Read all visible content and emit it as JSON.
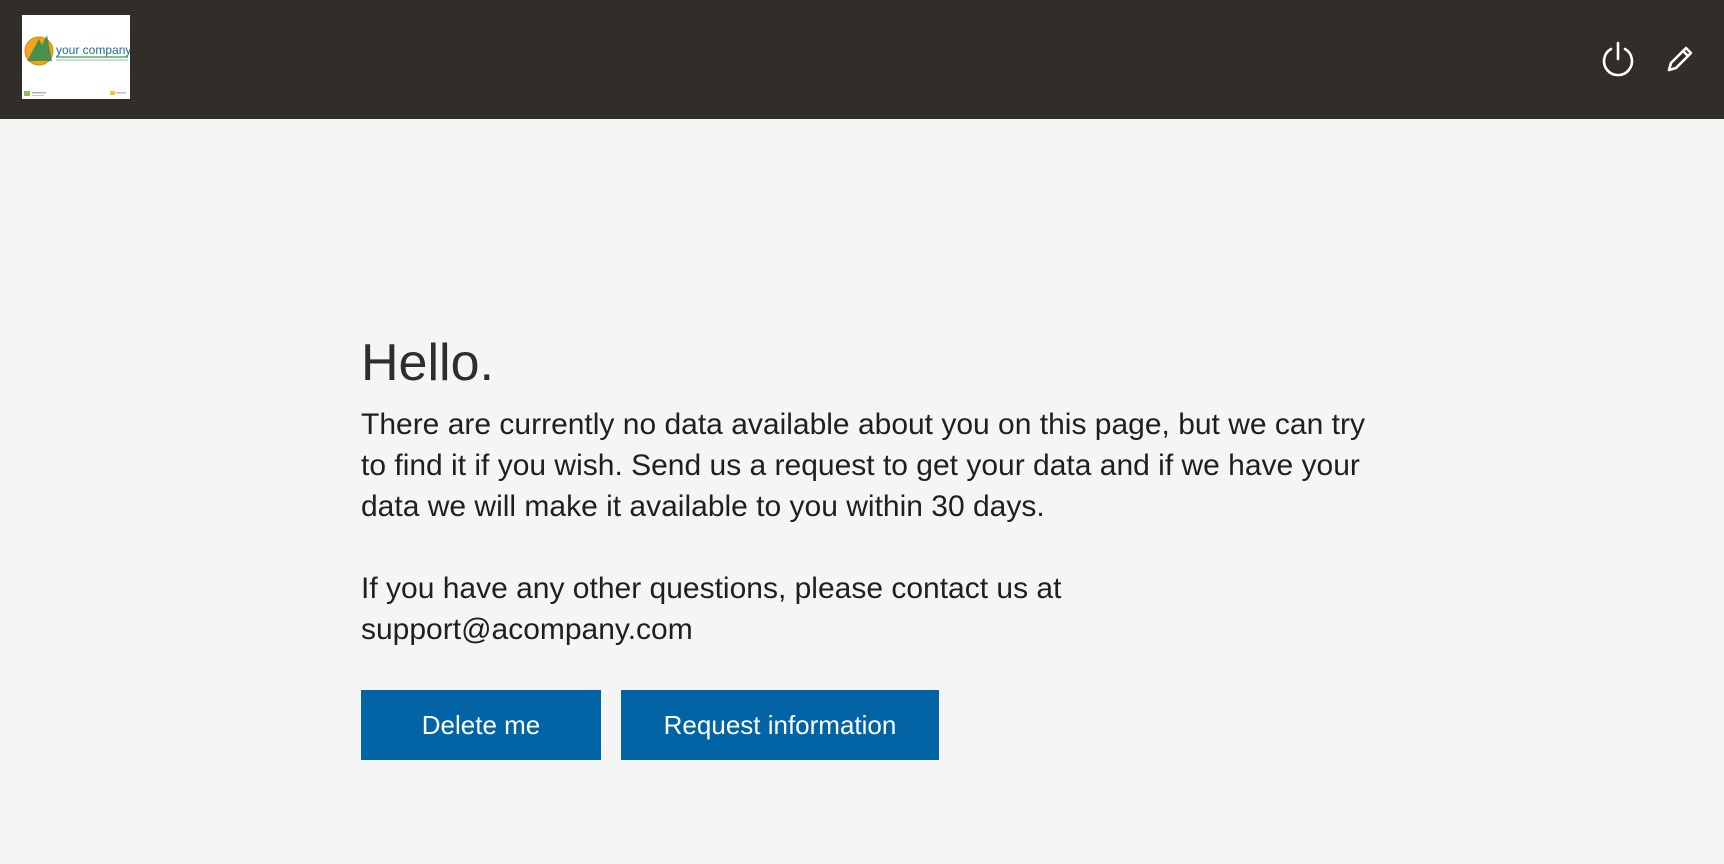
{
  "header": {
    "logo": {
      "text": "your company",
      "icon": "company-logo-icon"
    },
    "actions": [
      {
        "icon": "power-icon",
        "name": "logout"
      },
      {
        "icon": "pencil-icon",
        "name": "edit"
      }
    ],
    "background_color": "#312d28"
  },
  "main": {
    "title": "Hello.",
    "paragraph1": "There are currently no data available about you on this page, but we can try to find it if you wish. Send us a request to get your data and if we have your data we will make it available to you within 30 days.",
    "paragraph2": "If you have any other questions, please contact us at support@acompany.com",
    "buttons": {
      "delete_label": "Delete me",
      "request_label": "Request information"
    },
    "button_color": "#0263a5"
  }
}
